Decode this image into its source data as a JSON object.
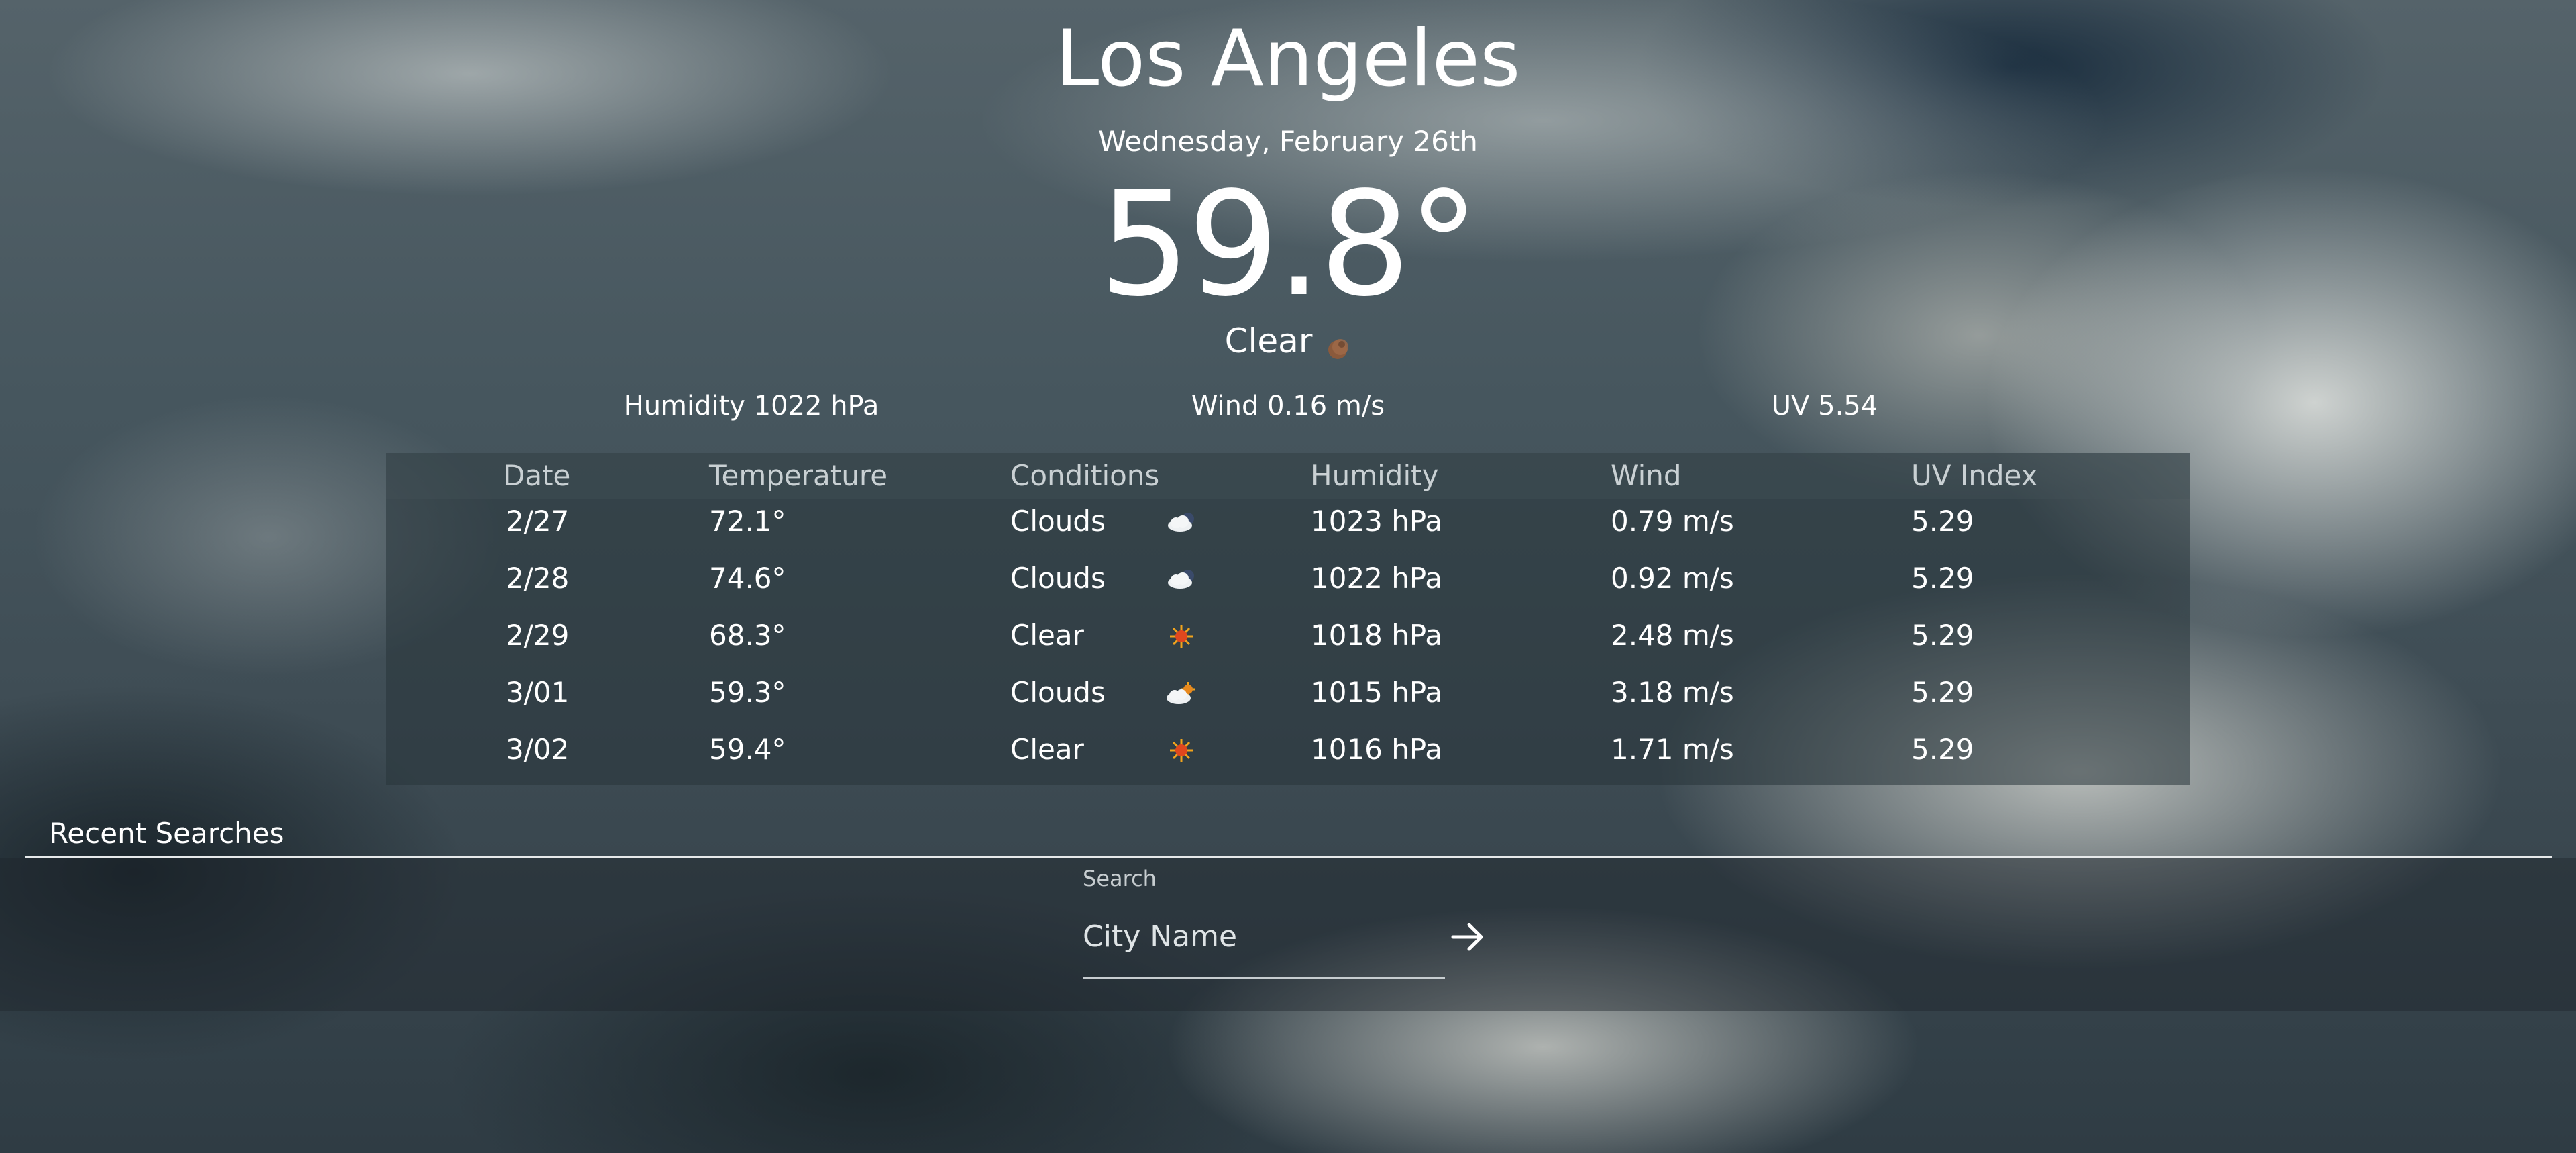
{
  "current": {
    "city": "Los Angeles",
    "date": "Wednesday, February 26th",
    "temperature": "59.8°",
    "condition": "Clear",
    "condition_icon": "clear-moon-icon",
    "humidity": "Humidity 1022 hPa",
    "wind": "Wind 0.16 m/s",
    "uv": "UV 5.54"
  },
  "forecast": {
    "headers": [
      "Date",
      "Temperature",
      "Conditions",
      "Humidity",
      "Wind",
      "UV Index"
    ],
    "rows": [
      {
        "date": "2/27",
        "temp": "72.1°",
        "cond": "Clouds",
        "icon": "clouds-night-icon",
        "humidity": "1023 hPa",
        "wind": "0.79 m/s",
        "uv": "5.29"
      },
      {
        "date": "2/28",
        "temp": "74.6°",
        "cond": "Clouds",
        "icon": "clouds-night-icon",
        "humidity": "1022 hPa",
        "wind": "0.92 m/s",
        "uv": "5.29"
      },
      {
        "date": "2/29",
        "temp": "68.3°",
        "cond": "Clear",
        "icon": "sun-icon",
        "humidity": "1018 hPa",
        "wind": "2.48 m/s",
        "uv": "5.29"
      },
      {
        "date": "3/01",
        "temp": "59.3°",
        "cond": "Clouds",
        "icon": "cloud-sun-icon",
        "humidity": "1015 hPa",
        "wind": "3.18 m/s",
        "uv": "5.29"
      },
      {
        "date": "3/02",
        "temp": "59.4°",
        "cond": "Clear",
        "icon": "sun-icon",
        "humidity": "1016 hPa",
        "wind": "1.71 m/s",
        "uv": "5.29"
      }
    ]
  },
  "recent": {
    "title": "Recent Searches"
  },
  "search": {
    "label": "Search",
    "placeholder": "City Name",
    "value": "",
    "button_icon": "arrow-right-icon"
  }
}
